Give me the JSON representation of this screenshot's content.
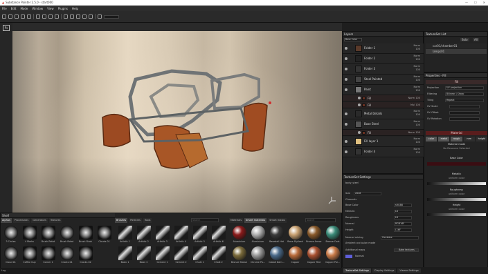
{
  "app": {
    "title": "Substance Painter 2.5.0 - start000"
  },
  "menu": [
    "File",
    "Edit",
    "Mode",
    "Window",
    "View",
    "Plugins",
    "Help"
  ],
  "left_strip": {
    "button": "Ps"
  },
  "layers": {
    "title": "Layers",
    "blend_mode": "Base Color",
    "rows": [
      {
        "name": "Folder 1",
        "blend": "Norm",
        "value": "100"
      },
      {
        "name": "Folder 2",
        "blend": "Norm",
        "value": "100"
      },
      {
        "name": "Folder 3",
        "blend": "Norm",
        "value": "100"
      },
      {
        "name": "Steel Painted",
        "blend": "Norm",
        "value": "100"
      },
      {
        "name": "Paint",
        "blend": "Norm",
        "value": "100"
      },
      {
        "name": "Fill",
        "blend": "Norm",
        "value": "100",
        "sub": true
      },
      {
        "name": "Fill",
        "blend": "Mul",
        "value": "100",
        "sub": true
      },
      {
        "name": "Metal Details",
        "blend": "Norm",
        "value": "100"
      },
      {
        "name": "Base Steel",
        "blend": "Norm",
        "value": "100"
      },
      {
        "name": "Fill",
        "blend": "Norm",
        "value": "100",
        "sub": true
      },
      {
        "name": "Fill layer 1",
        "blend": "Norm",
        "value": "100"
      },
      {
        "name": "Folder 4",
        "blend": "Norm",
        "value": "100"
      }
    ]
  },
  "texture_set_settings": {
    "title": "TextureSet Settings",
    "set_name": "body_steel",
    "size_label": "Size",
    "size_value": "2048",
    "channels_label": "Channels",
    "channels": [
      {
        "name": "Base Color",
        "format": "sRGB8"
      },
      {
        "name": "Metallic",
        "format": "L8"
      },
      {
        "name": "Roughness",
        "format": "L8"
      },
      {
        "name": "Normal",
        "format": "RGB16F"
      },
      {
        "name": "Height",
        "format": "L16F"
      }
    ],
    "normal_mixing_label": "Normal mixing",
    "normal_mixing_value": "Combine",
    "ao_label": "Ambient occlusion mode",
    "additional_maps_label": "Additional maps",
    "bake_button": "Bake textures",
    "normal_channel": "Normal"
  },
  "texture_set_list": {
    "title": "TextureSet List",
    "buttons": [
      "Solo",
      "All"
    ],
    "items": [
      "car01/chamber01",
      "lamps01"
    ]
  },
  "properties": {
    "title": "Properties - Fill",
    "fill_section": "Fill",
    "projection_label": "Projection",
    "projection_value": "UV projection",
    "filtering_label": "Filtering",
    "filtering_value": "Bilinear | Sharp",
    "tiling_label": "Tiling",
    "tiling_value": "Repeat",
    "uv_scale_label": "UV Scale",
    "uv_offset_label": "UV Offset",
    "uv_rotation_label": "UV Rotation",
    "material_section": "Material",
    "material_buttons": [
      "color",
      "metal",
      "rough",
      "nrm",
      "height"
    ],
    "material_mode_label": "Material mode",
    "material_mode_value": "No Resource Selected",
    "base_color_label": "Base Color",
    "metallic_label": "Metallic",
    "metallic_sub": "uniform color",
    "roughness_label": "Roughness",
    "roughness_sub": "uniform color",
    "height_label": "Height",
    "height_sub": "uniform color",
    "ops": "ops"
  },
  "shelf": {
    "title": "Shelf",
    "tabs": [
      "Alphas",
      "Procedurals",
      "Generators",
      "Textures"
    ],
    "alphas": [
      "3 Circles",
      "4 Marks",
      "Brush Rotat",
      "Brush Rotat",
      "Brush Strok",
      "Clouds 01",
      "Cloud 01",
      "Coffee Cup",
      "Corner 1",
      "Cracks 01",
      "Cracks 02"
    ],
    "brush_tabs": [
      "Brushes",
      "Particles",
      "Tools"
    ],
    "brushes": [
      "Artistic 1",
      "Artistic 2",
      "Artistic 3",
      "Artistic 4",
      "Artistic 5",
      "Artistic 6",
      "Basic 1",
      "Basic 2",
      "Cement 1",
      "Cement 2",
      "Chalk 1",
      "Chalk 2"
    ],
    "material_tabs": [
      "Materials",
      "Smart materials",
      "Smart masks"
    ],
    "materials": [
      "Aluminium",
      "Aluminium",
      "Baseball Hat",
      "Bone Stylized",
      "Bronze Armor",
      "Bronze Coat",
      "Bronze Statue",
      "Chrome Pa...",
      "Cobalt Dam...",
      "Copper",
      "Copper Red",
      "Copper Pai..."
    ],
    "search_placeholder": "Search"
  },
  "status": {
    "text": "Log"
  },
  "bottom_tabs": [
    "TextureSet Settings",
    "Display Settings",
    "Viewer Settings"
  ]
}
